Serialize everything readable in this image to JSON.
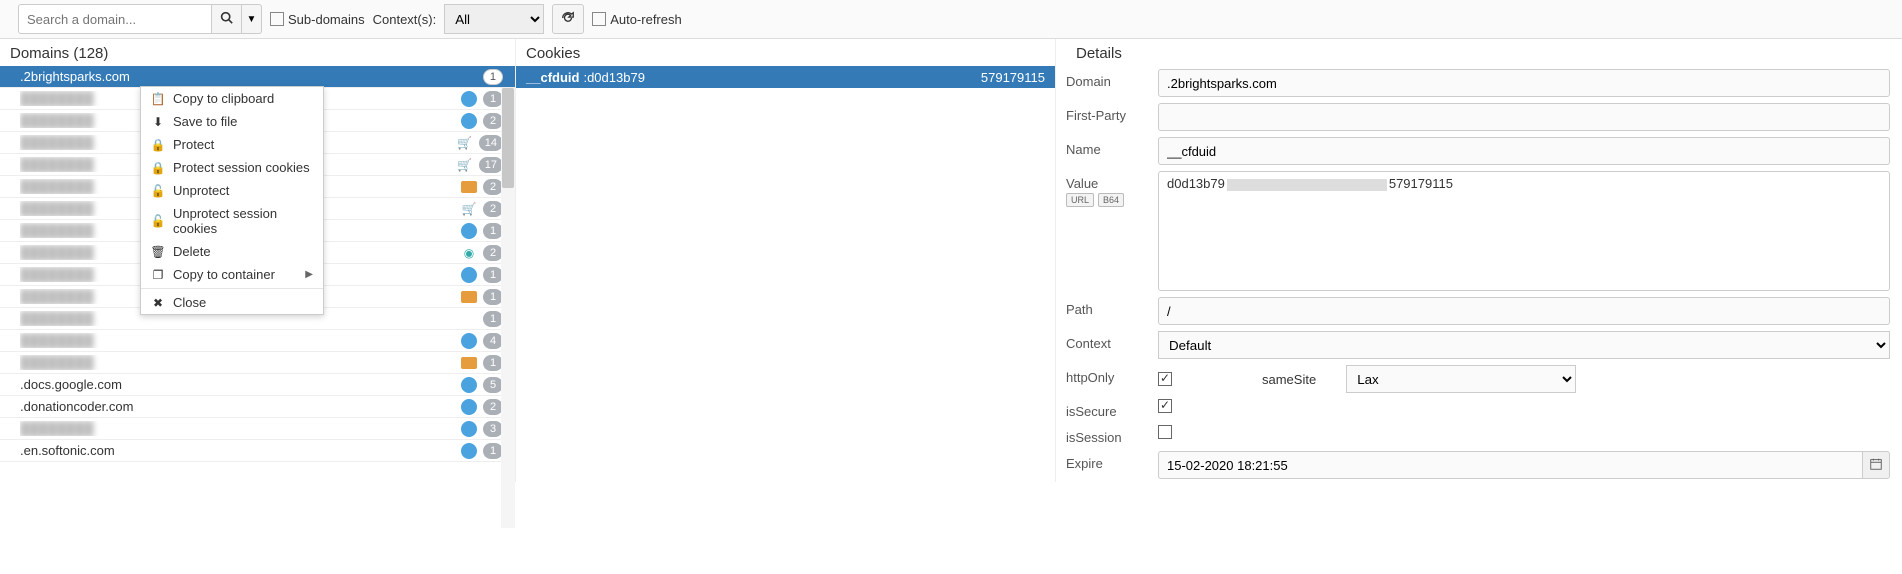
{
  "toolbar": {
    "search_placeholder": "Search a domain...",
    "subdomains_label": "Sub-domains",
    "contexts_label": "Context(s):",
    "contexts_value": "All",
    "autorefresh_label": "Auto-refresh"
  },
  "domains": {
    "title": "Domains (128)",
    "items": [
      {
        "name": ".2brightsparks.com",
        "badge": "1",
        "icon": "none",
        "selected": true,
        "badge_style": "white"
      },
      {
        "name": "",
        "badge": "1",
        "icon": "blue",
        "blur": true
      },
      {
        "name": "",
        "badge": "2",
        "icon": "blue",
        "blur": true
      },
      {
        "name": "",
        "badge": "14",
        "icon": "cart",
        "blur": true
      },
      {
        "name": "",
        "badge": "17",
        "icon": "cart",
        "blur": true
      },
      {
        "name": "",
        "badge": "2",
        "icon": "box",
        "blur": true
      },
      {
        "name": "",
        "badge": "2",
        "icon": "cart",
        "blur": true
      },
      {
        "name": "",
        "badge": "1",
        "icon": "blue",
        "blur": true
      },
      {
        "name": "",
        "badge": "2",
        "icon": "spiral",
        "blur": true
      },
      {
        "name": "",
        "badge": "1",
        "icon": "blue",
        "blur": true
      },
      {
        "name": "",
        "badge": "1",
        "icon": "box",
        "blur": true
      },
      {
        "name": "",
        "badge": "1",
        "icon": "none",
        "blur": true
      },
      {
        "name": "",
        "badge": "4",
        "icon": "blue",
        "blur": true
      },
      {
        "name": "",
        "badge": "1",
        "icon": "box",
        "blur": true
      },
      {
        "name": ".docs.google.com",
        "badge": "5",
        "icon": "blue"
      },
      {
        "name": ".donationcoder.com",
        "badge": "2",
        "icon": "blue"
      },
      {
        "name": ".",
        "badge": "3",
        "icon": "blue",
        "blur": true
      },
      {
        "name": ".en.softonic.com",
        "badge": "1",
        "icon": "blue"
      }
    ]
  },
  "context_menu": {
    "items": [
      {
        "icon": "📋",
        "label": "Copy to clipboard"
      },
      {
        "icon": "⬇",
        "label": "Save to file"
      },
      {
        "icon": "🔒",
        "label": "Protect"
      },
      {
        "icon": "🔒",
        "label": "Protect session cookies"
      },
      {
        "icon": "🔓",
        "label": "Unprotect"
      },
      {
        "icon": "🔓",
        "label": "Unprotect session cookies"
      },
      {
        "icon": "🗑",
        "label": "Delete"
      },
      {
        "icon": "❐",
        "label": "Copy to container",
        "submenu": true
      }
    ],
    "close_label": "Close"
  },
  "cookies": {
    "title": "Cookies",
    "items": [
      {
        "name": "__cfduid",
        "v1": ":d0d13b79",
        "v2": "579179115"
      }
    ]
  },
  "details": {
    "title": "Details",
    "labels": {
      "domain": "Domain",
      "firstparty": "First-Party",
      "name": "Name",
      "value": "Value",
      "path": "Path",
      "context": "Context",
      "httponly": "httpOnly",
      "samesite": "sameSite",
      "issecure": "isSecure",
      "issession": "isSession",
      "expire": "Expire"
    },
    "values": {
      "domain": ".2brightsparks.com",
      "firstparty": "",
      "name": "__cfduid",
      "value_p1": "d0d13b79",
      "value_p2": "579179115",
      "url_badge": "URL",
      "b64_badge": "B64",
      "path": "/",
      "context": "Default",
      "httponly": true,
      "samesite": "Lax",
      "issecure": true,
      "issession": false,
      "expire": "15-02-2020 18:21:55"
    }
  }
}
